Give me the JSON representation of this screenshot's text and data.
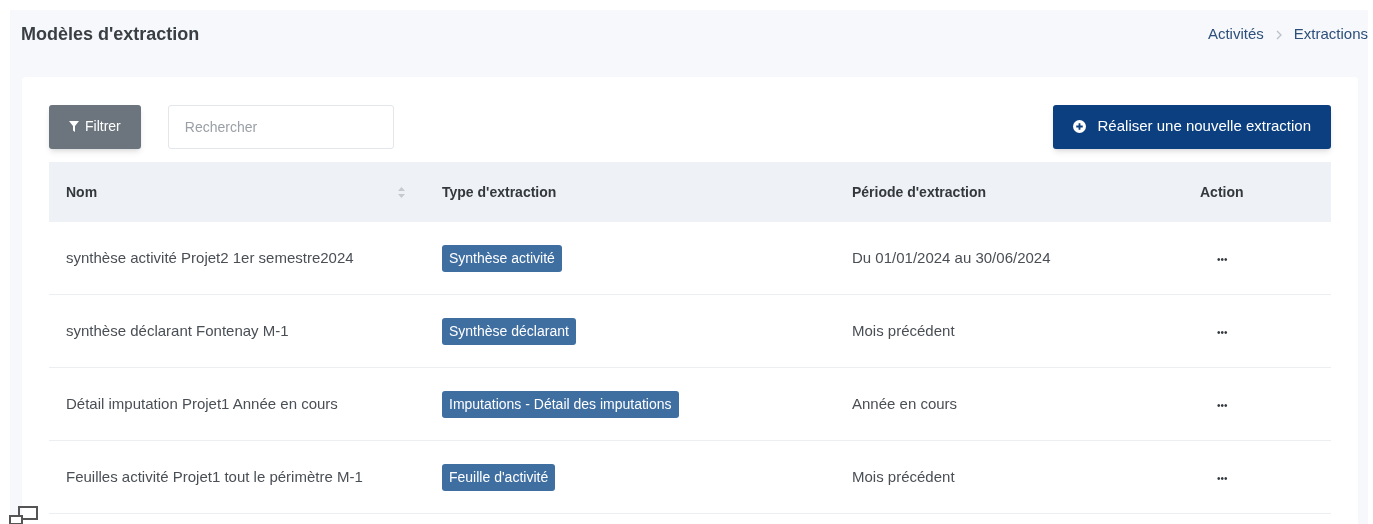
{
  "page": {
    "title": "Modèles d'extraction"
  },
  "breadcrumb": [
    "Activités",
    "Extractions"
  ],
  "toolbar": {
    "filter_button": "Filtrer",
    "search": {
      "placeholder": "Rechercher"
    },
    "new_button": "Réaliser une nouvelle extraction"
  },
  "table": {
    "columns": [
      {
        "label": "Nom",
        "sortable": true
      },
      {
        "label": "Type d'extraction",
        "sortable": false
      },
      {
        "label": "Période d'extraction",
        "sortable": false
      },
      {
        "label": "Action",
        "sortable": false
      }
    ],
    "rows": [
      {
        "name": "synthèse activité Projet2 1er semestre2024",
        "type": "Synthèse activité",
        "period": "Du 01/01/2024 au 30/06/2024",
        "action": "•••"
      },
      {
        "name": "synthèse déclarant Fontenay M-1",
        "type": "Synthèse déclarant",
        "period": "Mois précédent",
        "action": "•••"
      },
      {
        "name": "Détail imputation Projet1 Année en cours",
        "type": "Imputations - Détail des imputations",
        "period": "Année en cours",
        "action": "•••"
      },
      {
        "name": "Feuilles activité Projet1 tout le périmètre M-1",
        "type": "Feuille d'activité",
        "period": "Mois précédent",
        "action": "•••"
      }
    ]
  }
}
